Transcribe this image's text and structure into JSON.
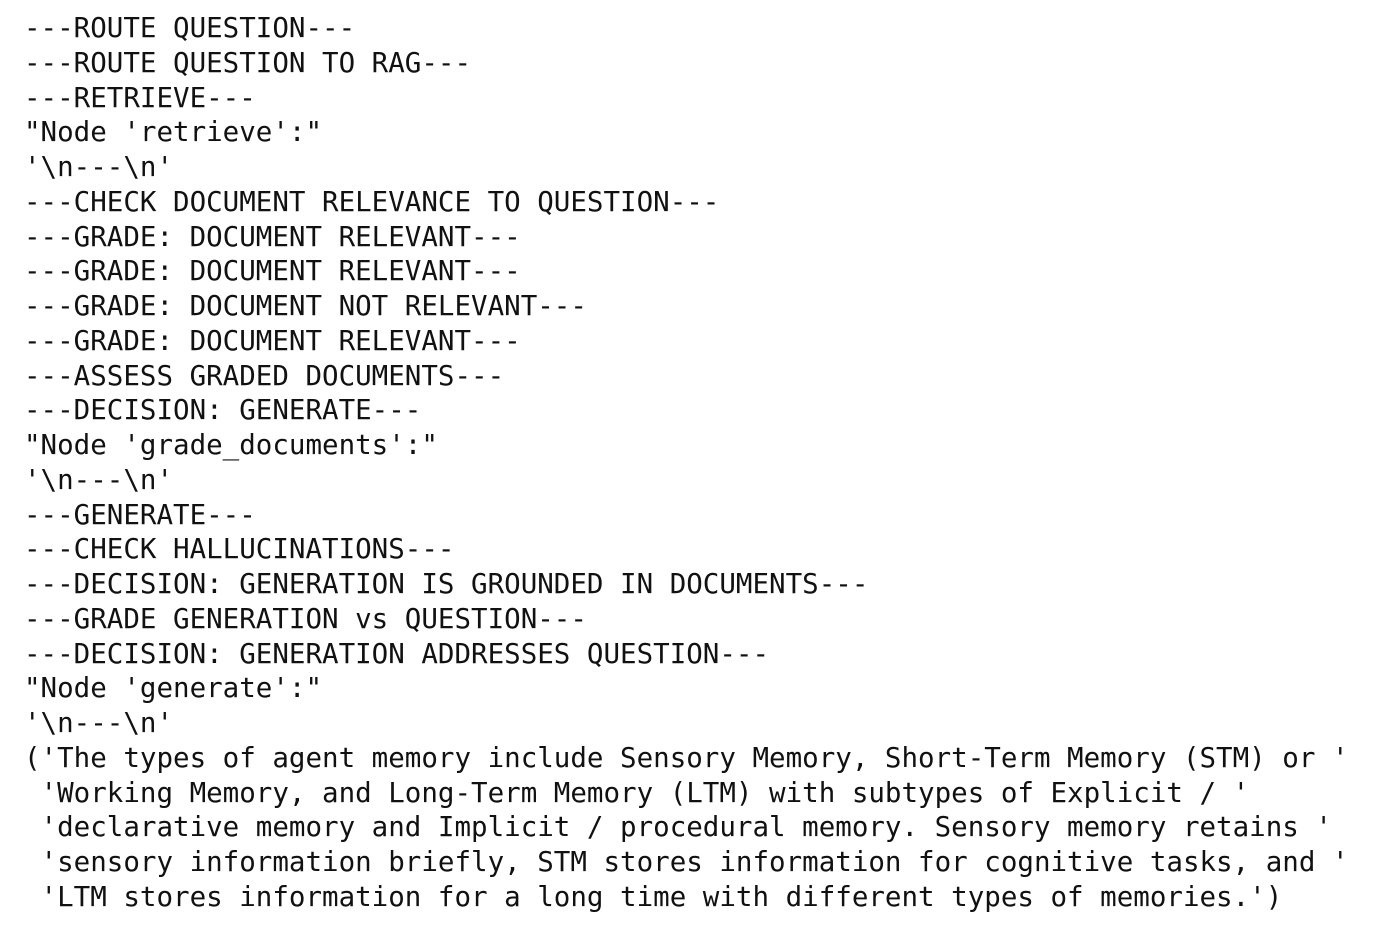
{
  "console": {
    "lines": [
      "---ROUTE QUESTION---",
      "---ROUTE QUESTION TO RAG---",
      "---RETRIEVE---",
      "\"Node 'retrieve':\"",
      "'\\n---\\n'",
      "---CHECK DOCUMENT RELEVANCE TO QUESTION---",
      "---GRADE: DOCUMENT RELEVANT---",
      "---GRADE: DOCUMENT RELEVANT---",
      "---GRADE: DOCUMENT NOT RELEVANT---",
      "---GRADE: DOCUMENT RELEVANT---",
      "---ASSESS GRADED DOCUMENTS---",
      "---DECISION: GENERATE---",
      "\"Node 'grade_documents':\"",
      "'\\n---\\n'",
      "---GENERATE---",
      "---CHECK HALLUCINATIONS---",
      "---DECISION: GENERATION IS GROUNDED IN DOCUMENTS---",
      "---GRADE GENERATION vs QUESTION---",
      "---DECISION: GENERATION ADDRESSES QUESTION---",
      "\"Node 'generate':\"",
      "'\\n---\\n'",
      "('The types of agent memory include Sensory Memory, Short-Term Memory (STM) or '",
      " 'Working Memory, and Long-Term Memory (LTM) with subtypes of Explicit / '",
      " 'declarative memory and Implicit / procedural memory. Sensory memory retains '",
      " 'sensory information briefly, STM stores information for cognitive tasks, and '",
      " 'LTM stores information for a long time with different types of memories.')"
    ]
  }
}
